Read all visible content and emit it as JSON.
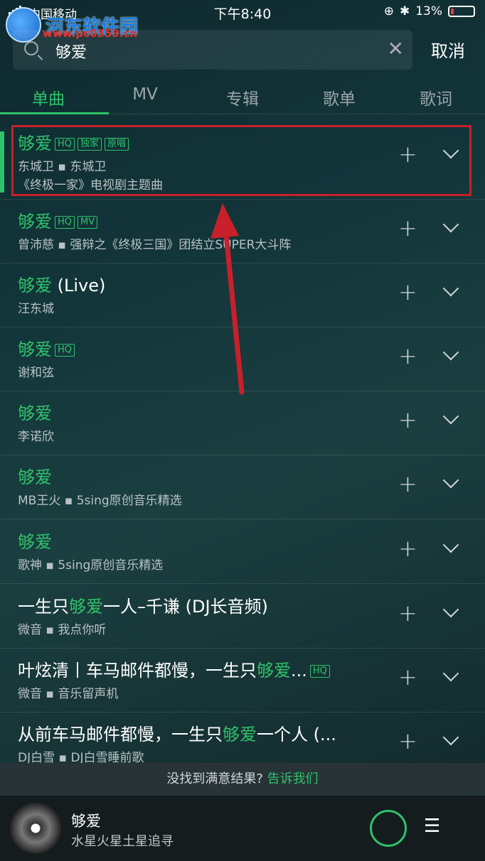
{
  "status_bar": {
    "carrier": "中国移动",
    "time": "下午8:40",
    "battery": "13%",
    "battery_level": 0.13
  },
  "watermark": {
    "name": "河东软件园",
    "url": "www.pc0359.cn"
  },
  "search": {
    "query": "够爱",
    "cancel_label": "取消"
  },
  "tabs": [
    {
      "label": "单曲"
    },
    {
      "label": "MV"
    },
    {
      "label": "专辑"
    },
    {
      "label": "歌单"
    },
    {
      "label": "歌词"
    }
  ],
  "results": [
    {
      "pre": "",
      "hl": "够爱",
      "post": "",
      "badges": [
        "HQ",
        "独家",
        "原唱"
      ],
      "artist": "东城卫",
      "source": "东城卫",
      "desc": "《终极一家》电视剧主题曲"
    },
    {
      "pre": "",
      "hl": "够爱",
      "post": "",
      "badges": [
        "HQ",
        "MV"
      ],
      "artist": "曾沛慈",
      "source": "强辩之《终极三国》团结立SUPER大斗阵"
    },
    {
      "pre": "",
      "hl": "够爱",
      "post": " (Live)",
      "badges": [],
      "artist": "汪东城",
      "source": ""
    },
    {
      "pre": "",
      "hl": "够爱",
      "post": "",
      "badges": [
        "HQ"
      ],
      "artist": "谢和弦",
      "source": ""
    },
    {
      "pre": "",
      "hl": "够爱",
      "post": "",
      "badges": [],
      "artist": "李诺欣",
      "source": ""
    },
    {
      "pre": "",
      "hl": "够爱",
      "post": "",
      "badges": [],
      "artist": "MB王火",
      "source": "5sing原创音乐精选"
    },
    {
      "pre": "",
      "hl": "够爱",
      "post": "",
      "badges": [],
      "artist": "歌神",
      "source": "5sing原创音乐精选"
    },
    {
      "pre": "一生只",
      "hl": "够爱",
      "post": "一人–千谦 (DJ长音频)",
      "badges": [],
      "artist": "微音",
      "source": "我点你听"
    },
    {
      "pre": "叶炫清丨车马邮件都慢，一生只",
      "hl": "够爱",
      "post": "...",
      "badges": [
        "HQ"
      ],
      "artist": "微音",
      "source": "音乐留声机"
    },
    {
      "pre": "从前车马邮件都慢，一生只",
      "hl": "够爱",
      "post": "一个人 (...",
      "badges": [],
      "artist": "DJ白雪",
      "source": "DJ白雪睡前歌"
    }
  ],
  "feedback": {
    "text": "没找到满意结果?",
    "link": "告诉我们"
  },
  "player": {
    "song": "够爱",
    "lyric": "水星火星土星追寻"
  },
  "colors": {
    "accent": "#2fc26a",
    "highlight_box": "#c8202a"
  }
}
